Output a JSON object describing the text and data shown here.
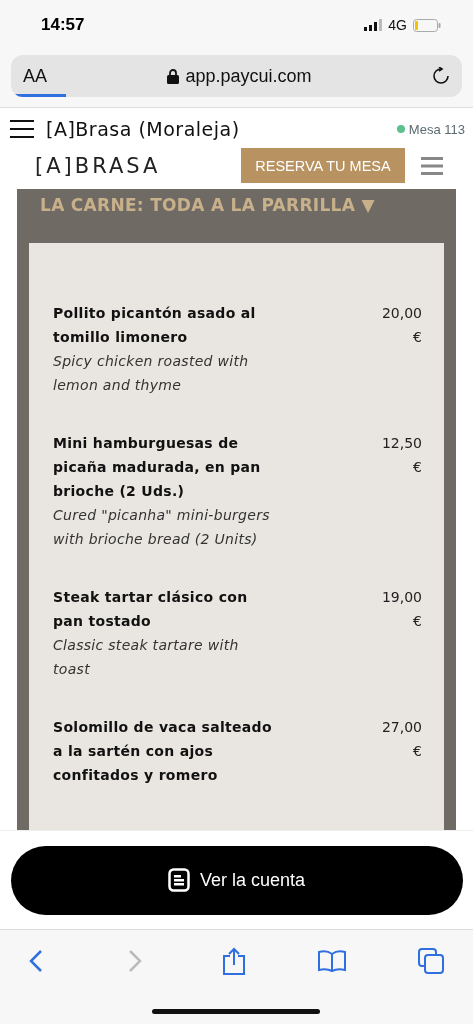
{
  "status_bar": {
    "time": "14:57",
    "network": "4G"
  },
  "browser": {
    "text_size": "AA",
    "url": "app.paycui.com"
  },
  "header": {
    "title": "[A]Brasa (Moraleja)",
    "table": {
      "label": "Mesa 113",
      "color": "#5cc08f"
    }
  },
  "site_nav": {
    "logo": "[A]BRASA",
    "reserve_button": "RESERVA TU MESA"
  },
  "menu": {
    "section": {
      "title": "LA CARNE: TODA A LA PARRILLA",
      "caret": "▼"
    },
    "items": [
      {
        "name": "Pollito picantón asado al tomillo limonero",
        "description": "Spicy chicken roasted with lemon and thyme",
        "price": "20,00 €"
      },
      {
        "name": "Mini hamburguesas de picaña madurada, en pan brioche (2 Uds.)",
        "description": "Cured \"picanha\" mini-burgers with brioche bread (2 Units)",
        "price": "12,50 €"
      },
      {
        "name": "Steak tartar clásico con pan tostado",
        "description": "Classic steak tartare with toast",
        "price": "19,00 €"
      },
      {
        "name": "Solomillo de vaca salteado a la sartén con ajos confitados y romero",
        "price": "27,00 €"
      }
    ]
  },
  "bill_button": {
    "label": "Ver la cuenta"
  }
}
